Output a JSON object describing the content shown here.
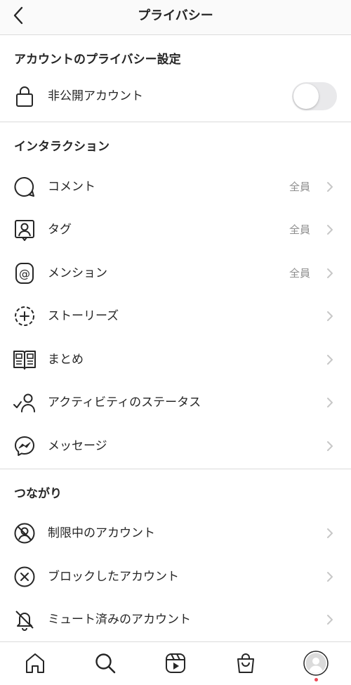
{
  "header": {
    "title": "プライバシー"
  },
  "sections": {
    "account": {
      "title": "アカウントのプライバシー設定"
    },
    "interaction": {
      "title": "インタラクション"
    },
    "connections": {
      "title": "つながり"
    }
  },
  "private_account": {
    "label": "非公開アカウント",
    "enabled": false
  },
  "interaction_items": [
    {
      "label": "コメント",
      "value": "全員",
      "icon": "comment-icon"
    },
    {
      "label": "タグ",
      "value": "全員",
      "icon": "tag-icon"
    },
    {
      "label": "メンション",
      "value": "全員",
      "icon": "mention-icon"
    },
    {
      "label": "ストーリーズ",
      "value": "",
      "icon": "story-plus-icon"
    },
    {
      "label": "まとめ",
      "value": "",
      "icon": "guide-book-icon"
    },
    {
      "label": "アクティビティのステータス",
      "value": "",
      "icon": "activity-status-icon"
    },
    {
      "label": "メッセージ",
      "value": "",
      "icon": "messenger-icon"
    }
  ],
  "connection_items": [
    {
      "label": "制限中のアカウント",
      "icon": "restricted-icon"
    },
    {
      "label": "ブロックしたアカウント",
      "icon": "blocked-icon"
    },
    {
      "label": "ミュート済みのアカウント",
      "icon": "muted-bell-icon"
    }
  ],
  "tabbar": {
    "tabs": [
      "home-icon",
      "search-icon",
      "reels-icon",
      "shop-icon",
      "profile-avatar"
    ],
    "notification_color": "#ed4956"
  }
}
